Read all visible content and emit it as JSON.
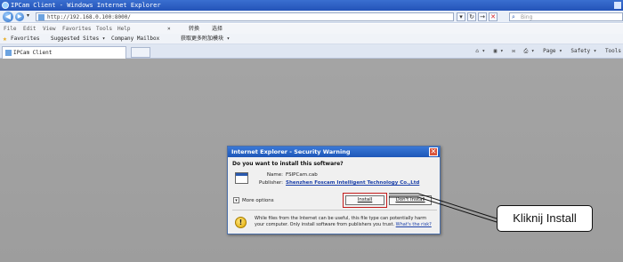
{
  "window": {
    "title": "IPCam Client - Windows Internet Explorer"
  },
  "address_bar": {
    "url": "http://192.168.0.100:8000/",
    "search_placeholder": "Bing"
  },
  "menu": {
    "items": [
      "File",
      "Edit",
      "View",
      "Favorites",
      "Tools",
      "Help"
    ],
    "toolbar_close": "×",
    "translate_label": "转换",
    "select_label": "选择"
  },
  "favorites_bar": {
    "favorites_label": "Favorites",
    "suggested_sites": "Suggested Sites ▾",
    "company_mailbox": "Company Mailbox",
    "more_addons": "获取更多附加模块 ▾"
  },
  "tab": {
    "title": "IPCam Client"
  },
  "command_bar": {
    "page": "Page ▾",
    "safety": "Safety ▾",
    "tools": "Tools"
  },
  "dialog": {
    "title": "Internet Explorer - Security Warning",
    "question": "Do you want to install this software?",
    "name_label": "Name:",
    "name_value": "FSIPCam.cab",
    "publisher_label": "Publisher:",
    "publisher_value": "Shenzhen Foscam Intelligent Technology Co.,Ltd",
    "more_options": "More options",
    "install_button": "Install",
    "dont_install_button": "Don't Install",
    "warning_text": "While files from the Internet can be useful, this file type can potentially harm your computer. Only install software from publishers you trust.",
    "risk_link": "What's the risk?"
  },
  "callout": {
    "text": "Kliknij Install"
  },
  "colors": {
    "highlight": "#c41c1c",
    "titlebar": "#2353b8",
    "content_bg": "#a2a2a2"
  }
}
